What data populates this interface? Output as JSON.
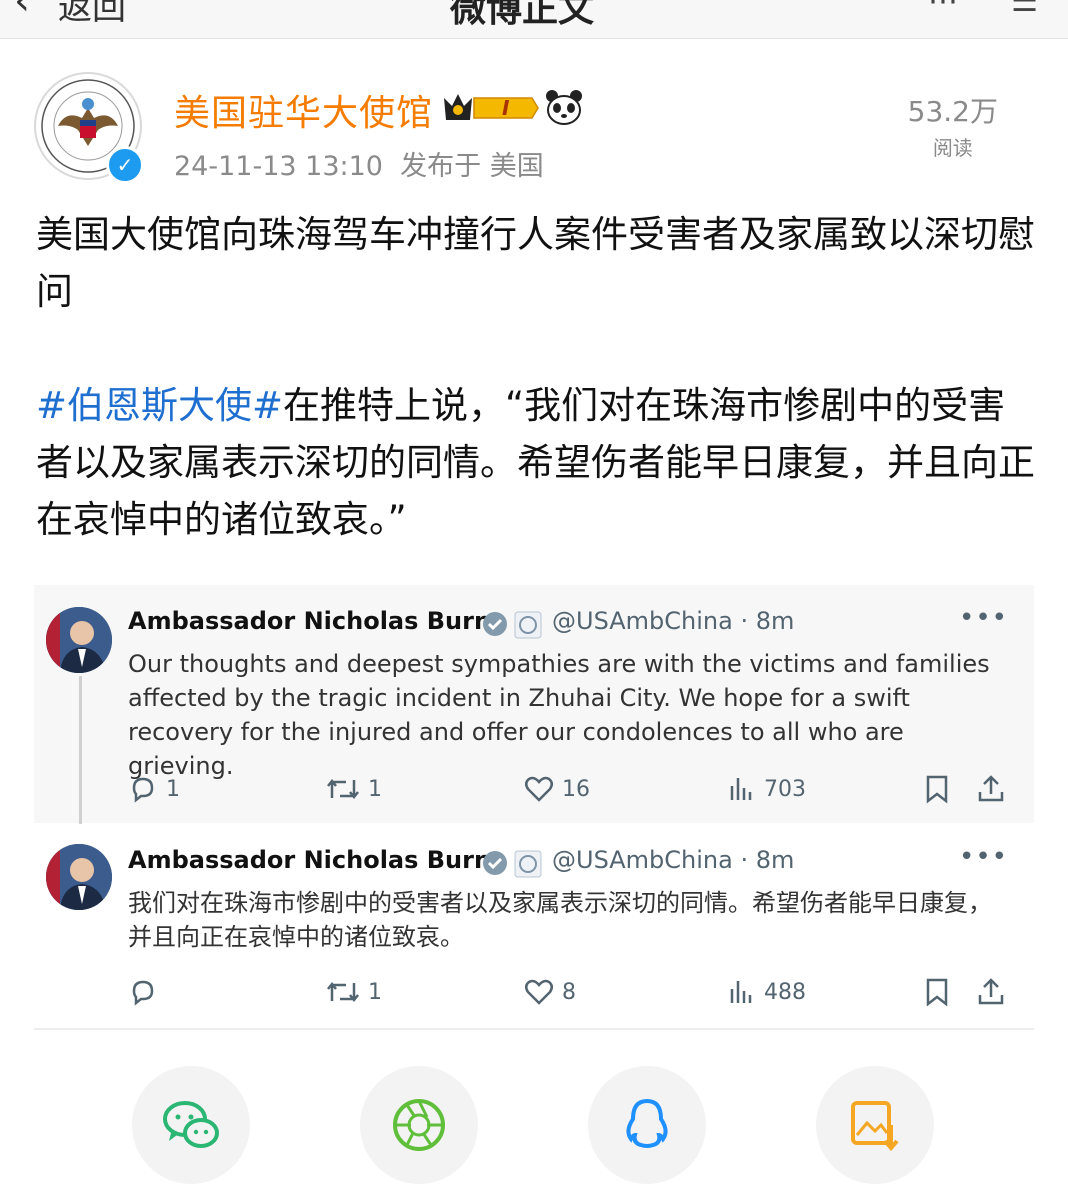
{
  "topbar": {
    "back_label": "返回",
    "title": "微博正文"
  },
  "header": {
    "username": "美国驻华大使馆",
    "level_badge": "I",
    "timestamp": "24-11-13 13:10",
    "location": "发布于 美国",
    "read_count": "53.2万",
    "read_label": "阅读"
  },
  "post": {
    "line1": "美国大使馆向珠海驾车冲撞行人案件受害者及家属致以深切慰问",
    "hashtag": "#伯恩斯大使#",
    "line2": "在推特上说，“我们对在珠海市惨剧中的受害者以及家属表示深切的同情。希望伤者能早日康复，并且向正在哀悼中的诸位致哀。”"
  },
  "tweets": [
    {
      "name": "Ambassador Nicholas Burns",
      "handle": "@USAmbChina · 8m",
      "text": "Our thoughts and deepest sympathies are with the victims and families affected by the tragic incident in Zhuhai City. We hope for a swift recovery for the injured and offer our condolences to all who are grieving.",
      "replies": "1",
      "retweets": "1",
      "likes": "16",
      "views": "703"
    },
    {
      "name": "Ambassador Nicholas Burns",
      "handle": "@USAmbChina · 8m",
      "text": "我们对在珠海市惨剧中的受害者以及家属表示深切的同情。希望伤者能早日康复，并且向正在哀悼中的诸位致哀。",
      "replies": "",
      "retweets": "1",
      "likes": "8",
      "views": "488"
    }
  ],
  "share_icons": [
    "wechat-icon",
    "moments-icon",
    "qq-icon",
    "save-image-icon"
  ],
  "colors": {
    "username": "#f57c00",
    "hashtag": "#1f6fd1",
    "verified": "#1d9bf0",
    "share_wechat": "#2bb673",
    "share_moments": "#5fbf3a",
    "share_qq": "#1e90ff",
    "share_save": "#f5a623"
  }
}
